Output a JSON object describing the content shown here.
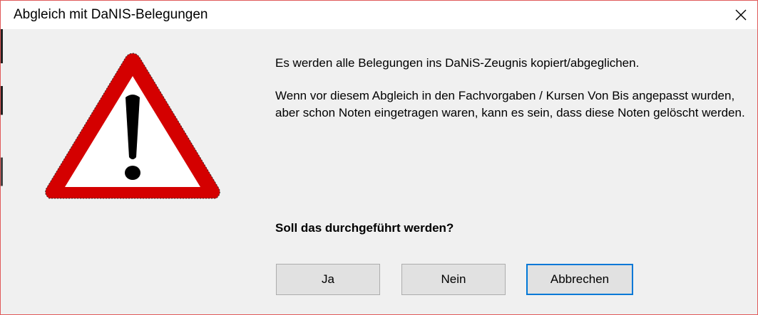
{
  "window": {
    "title": "Abgleich mit DaNIS-Belegungen",
    "close_glyph": "✕"
  },
  "message": {
    "line1": "Es werden alle Belegungen ins DaNiS-Zeugnis kopiert/abgeglichen.",
    "line2": "Wenn vor diesem Abgleich in den Fachvorgaben / Kursen Von Bis angepasst wurden, aber schon Noten eingetragen waren, kann es sein, dass diese Noten gelöscht werden.",
    "question": "Soll das durchgeführt werden?"
  },
  "buttons": {
    "yes": "Ja",
    "no": "Nein",
    "cancel": "Abbrechen"
  },
  "icon": {
    "name": "warning-icon",
    "border_color": "#d40000",
    "fill_color": "#ffffff",
    "mark_color": "#000000"
  },
  "colors": {
    "dialog_border": "#e05a5a",
    "default_button_border": "#0078d7"
  }
}
